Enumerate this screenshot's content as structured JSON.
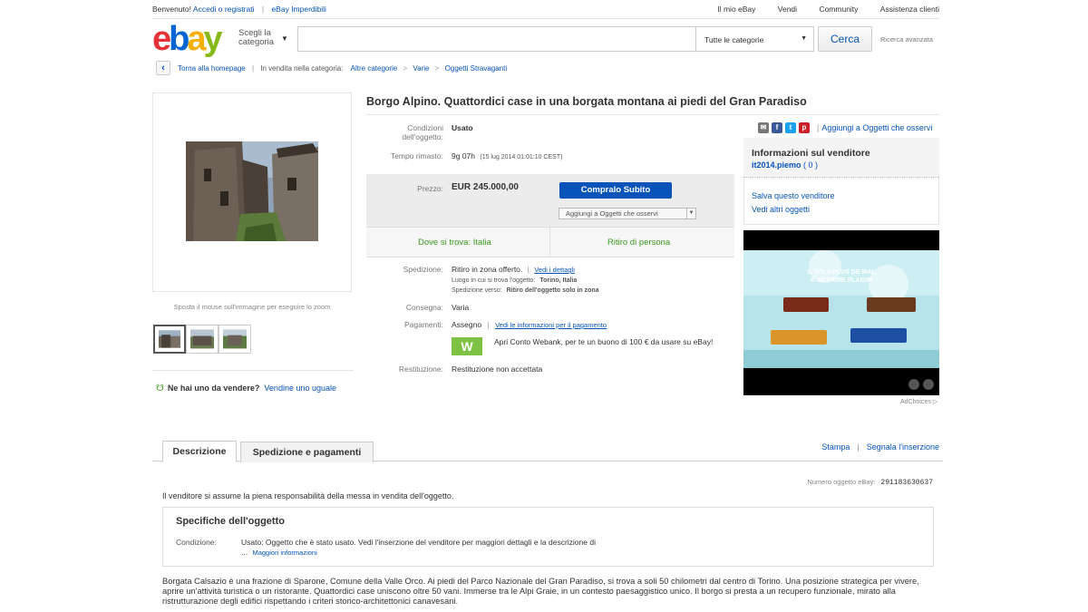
{
  "topbar": {
    "greeting": "Benvenuto!",
    "signin": "Accedi o registrati",
    "deals": "eBay Imperdibili",
    "my_ebay": "Il mio eBay",
    "sell": "Vendi",
    "community": "Community",
    "help": "Assistenza clienti"
  },
  "header": {
    "logo": [
      "e",
      "b",
      "a",
      "y"
    ],
    "category_picker": [
      "Scegli la",
      "categoria"
    ],
    "search_value": "",
    "category_select": "Tutte le categorie",
    "search_button": "Cerca",
    "advanced": "Ricerca avanzata"
  },
  "breadcrumb": {
    "back": "Torna alla homepage",
    "listed_in": "In vendita nella categoria:",
    "items": [
      "Altre categorie",
      "Varie",
      "Oggetti Stravaganti"
    ]
  },
  "gallery": {
    "zoom_hint": "Sposta il mouse sull'immagine per eseguire lo zoom"
  },
  "sell_one": {
    "question": "Ne hai uno da vendere?",
    "link": "Vendine uno uguale"
  },
  "listing": {
    "title": "Borgo Alpino. Quattordici case in una borgata montana ai piedi del Gran Paradiso",
    "condition_label": "Condizioni dell'oggetto:",
    "condition_value": "Usato",
    "time_label": "Tempo rimasto:",
    "time_value": "9g 07h",
    "time_date": "(15 lug 2014  01:01:10 CEST)",
    "price_label": "Prezzo:",
    "price_value": "EUR 245.000,00",
    "buy_button": "Compralo Subito",
    "watch_button": "Aggiungi a Oggetti che osservi",
    "location": "Dove si trova: Italia",
    "pickup": "Ritiro di persona",
    "shipping_label": "Spedizione:",
    "shipping_value": "Ritiro in zona offerto.",
    "shipping_details_link": "Vedi i dettagli",
    "item_location_label": "Luogo in cui si trova l'oggetto:",
    "item_location_value": "Torino, Italia",
    "ships_to_label": "Spedizione verso:",
    "ships_to_value": "Ritiro dell'oggetto solo in zona",
    "delivery_label": "Consegna:",
    "delivery_value": "Varia",
    "payments_label": "Pagamenti:",
    "payments_value": "Assegno",
    "payments_link": "Vedi le informazioni per il pagamento",
    "webank_icon": "W",
    "webank_text": "Apri Conto Webank, per te un buono di 100 € da usare su eBay!",
    "returns_label": "Restituzione:",
    "returns_value": "Restituzione non accettata"
  },
  "sidebar": {
    "watch_link": "Aggiungi a Oggetti che osservi",
    "seller_title": "Informazioni sul venditore",
    "seller_name": "it2014.piemo",
    "seller_feedback": "( 0 )",
    "save_seller": "Salva questo venditore",
    "other_items": "Vedi altri oggetti",
    "ad_line1": "IL N'Y A PLUS DE MAL",
    "ad_line2": "À SE FAIRE PLAISIR",
    "adchoices": "AdChoices"
  },
  "tabs": {
    "description": "Descrizione",
    "shipping": "Spedizione e pagamenti",
    "print": "Stampa",
    "report": "Segnala l'inserzione"
  },
  "description": {
    "item_number_label": "Numero oggetto eBay:",
    "item_number": "291183630637",
    "responsibility": "Il venditore si assume la piena responsabilità della messa in vendita dell'oggetto.",
    "specs_title": "Specifiche dell'oggetto",
    "spec_condition_label": "Condizione:",
    "spec_condition_value": "Usato: Oggetto che è stato usato. Vedi l'inserzione del venditore per maggiori dettagli e la descrizione di ...",
    "more_info": "Maggiori informazioni",
    "body": "Borgata Calsazio è una frazione di Sparone, Comune della Valle Orco. Ai piedi del Parco Nazionale del Gran Paradiso, si trova a soli 50 chilometri dal centro di Torino. Una posizione strategica per vivere, aprire un'attività turistica o un ristorante. Quattordici case uniscono oltre 50 vani. Immerse tra le Alpi Graie, in un contesto paesaggistico unico. Il borgo si presta a un recupero funzionale, mirato alla ristrutturazione degli edifici rispettando i criteri storico-architettonici canavesani."
  },
  "colors": {
    "link": "#0654ba",
    "buy_button": "#0654ba",
    "green": "#3b9a1e",
    "webank": "#7dc243"
  }
}
